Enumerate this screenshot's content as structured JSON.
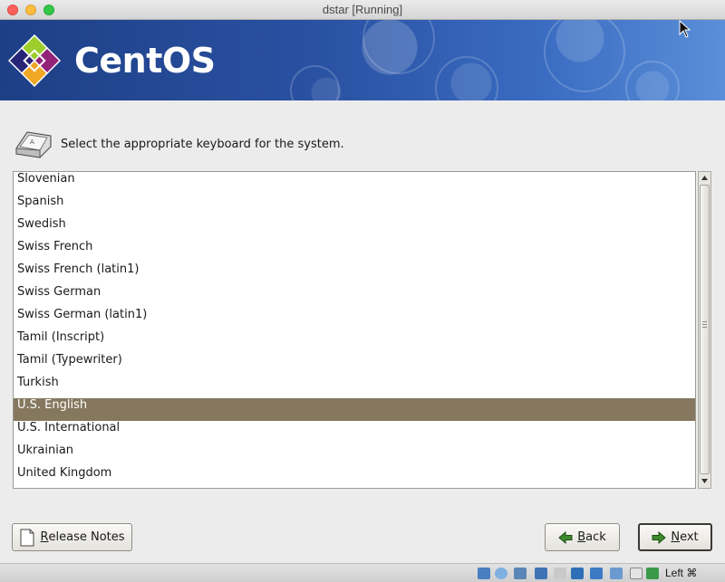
{
  "window": {
    "title": "dstar [Running]"
  },
  "banner": {
    "brand": "CentOS"
  },
  "prompt": {
    "text": "Select the appropriate keyboard for the system."
  },
  "keyboards": {
    "items": [
      "Slovenian",
      "Spanish",
      "Swedish",
      "Swiss French",
      "Swiss French (latin1)",
      "Swiss German",
      "Swiss German (latin1)",
      "Tamil (Inscript)",
      "Tamil (Typewriter)",
      "Turkish",
      "U.S. English",
      "U.S. International",
      "Ukrainian",
      "United Kingdom"
    ],
    "selected": "U.S. English"
  },
  "buttons": {
    "release_notes_underlined": "R",
    "release_notes_rest": "elease Notes",
    "back_underlined": "B",
    "back_rest": "ack",
    "next_underlined": "N",
    "next_rest": "ext"
  },
  "statusbar": {
    "host_key": "Left ⌘",
    "icons": [
      "hard-disk-icon",
      "optical-drive-icon",
      "audio-icon",
      "network-icon",
      "usb-icon",
      "shared-folder-icon",
      "display-icon",
      "video-capture-icon",
      "drag-drop-icon",
      "cpu-icon",
      "mouse-integration-icon",
      "keyboard-capture-icon"
    ]
  },
  "colors": {
    "selection": "#86785f",
    "banner": "#2a52a3"
  }
}
